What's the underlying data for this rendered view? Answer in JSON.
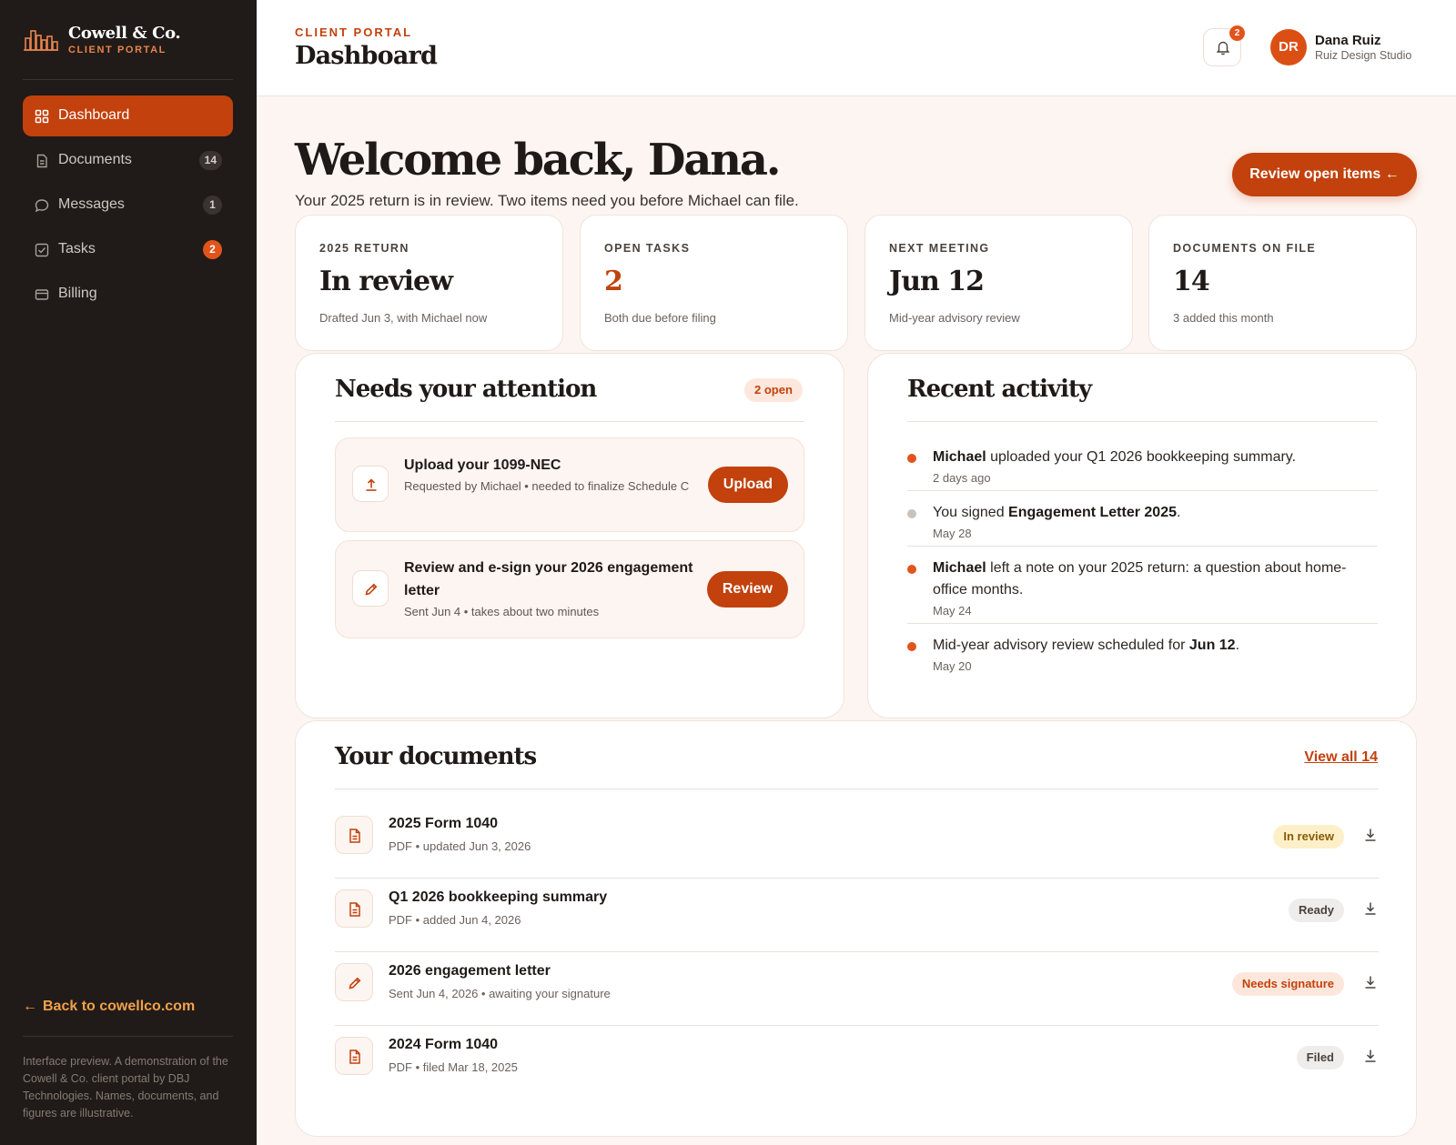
{
  "brand": {
    "name": "Cowell & Co.",
    "subtitle": "CLIENT PORTAL"
  },
  "sidebar": {
    "items": [
      {
        "label": "Dashboard",
        "icon": "grid-icon",
        "active": true
      },
      {
        "label": "Documents",
        "icon": "document-icon",
        "badge": "14"
      },
      {
        "label": "Messages",
        "icon": "chat-bubble-icon",
        "badge": "1"
      },
      {
        "label": "Tasks",
        "icon": "checkbox-icon",
        "badge": "2"
      },
      {
        "label": "Billing",
        "icon": "credit-card-icon"
      }
    ],
    "back_link": "Back to cowellco.com",
    "footnote": "Interface preview. A demonstration of the Cowell & Co. client portal by DBJ Technologies. Names, documents, and figures are illustrative."
  },
  "header": {
    "eyebrow": "CLIENT PORTAL",
    "title": "Dashboard",
    "notification_count": "2",
    "user": {
      "initials": "DR",
      "name": "Dana Ruiz",
      "org": "Ruiz Design Studio"
    }
  },
  "hero": {
    "title": "Welcome back, Dana.",
    "subtitle": "Your 2025 return is in review. Two items need you before Michael can file.",
    "cta": "Review open items"
  },
  "stats": [
    {
      "label": "2025 RETURN",
      "value": "In review",
      "sub": "Drafted Jun 3, with Michael now"
    },
    {
      "label": "OPEN TASKS",
      "value": "2",
      "sub": "Both due before filing"
    },
    {
      "label": "NEXT MEETING",
      "value": "Jun 12",
      "sub": "Mid-year advisory review"
    },
    {
      "label": "DOCUMENTS ON FILE",
      "value": "14",
      "sub": "3 added this month"
    }
  ],
  "attention": {
    "title": "Needs your attention",
    "badge": "2 open",
    "tasks": [
      {
        "title": "Upload your 1099-NEC",
        "sub": "Requested by Michael • needed to finalize Schedule C",
        "button": "Upload",
        "icon": "upload-icon"
      },
      {
        "title": "Review and e-sign your 2026 engagement letter",
        "sub": "Sent Jun 4 • takes about two minutes",
        "button": "Review",
        "icon": "pencil-icon"
      }
    ]
  },
  "activity": {
    "title": "Recent activity",
    "items": [
      {
        "pre": "",
        "bold": "Michael",
        "post": " uploaded your Q1 2026 bookkeeping summary.",
        "meta": "2 days ago",
        "dot": "#e1541c"
      },
      {
        "pre": "You signed ",
        "bold": "Engagement Letter 2025",
        "post": ".",
        "meta": "May 28",
        "dot": "#c9c1bc"
      },
      {
        "pre": "",
        "bold": "Michael",
        "post": " left a note on your 2025 return: a question about home-office months.",
        "meta": "May 24",
        "dot": "#e1541c"
      },
      {
        "pre": "Mid-year advisory review scheduled for ",
        "bold": "Jun 12",
        "post": ".",
        "meta": "May 20",
        "dot": "#e1541c"
      }
    ]
  },
  "documents": {
    "title": "Your documents",
    "view_all": "View all 14",
    "rows": [
      {
        "name": "2025 Form 1040",
        "meta": "PDF • updated Jun 3, 2026",
        "status": "In review",
        "icon": "file-icon"
      },
      {
        "name": "Q1 2026 bookkeeping summary",
        "meta": "PDF • added Jun 4, 2026",
        "status": "Ready",
        "icon": "file-icon"
      },
      {
        "name": "2026 engagement letter",
        "meta": "Sent Jun 4, 2026 • awaiting your signature",
        "status": "Needs signature",
        "icon": "pencil-icon"
      },
      {
        "name": "2024 Form 1040",
        "meta": "PDF • filed Mar 18, 2025",
        "status": "Filed",
        "icon": "file-icon"
      }
    ]
  },
  "colors": {
    "accent": "#c2410c",
    "accent_bright": "#e1541c",
    "sidebar_bg": "#201b18",
    "page_bg": "#fdf5f1",
    "link_gold": "#f2a04a"
  }
}
